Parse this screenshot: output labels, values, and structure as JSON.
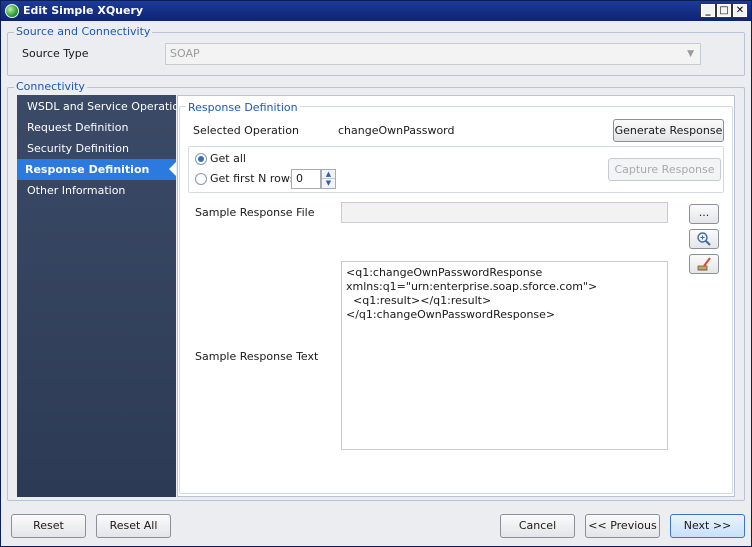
{
  "window": {
    "title": "Edit Simple XQuery"
  },
  "source_group": {
    "legend": "Source and Connectivity",
    "source_type_label": "Source Type",
    "source_type_value": "SOAP"
  },
  "connectivity": {
    "legend": "Connectivity",
    "nav": [
      {
        "label": "WSDL and Service Operation"
      },
      {
        "label": "Request Definition"
      },
      {
        "label": "Security Definition"
      },
      {
        "label": "Response Definition",
        "active": true
      },
      {
        "label": "Other Information"
      }
    ]
  },
  "response": {
    "legend": "Response Definition",
    "selected_operation_label": "Selected Operation",
    "selected_operation_value": "changeOwnPassword",
    "generate_button": "Generate Response",
    "get_all_label": "Get all",
    "get_first_label": "Get first N rows",
    "rows_value": "0",
    "capture_button": "Capture Response",
    "sample_file_label": "Sample Response File",
    "sample_file_value": "",
    "browse_button": "...",
    "sample_text_label": "Sample Response Text",
    "sample_text_value": "<q1:changeOwnPasswordResponse\nxmlns:q1=\"urn:enterprise.soap.sforce.com\">\n  <q1:result></q1:result></q1:changeOwnPasswordResponse>"
  },
  "footer": {
    "reset": "Reset",
    "reset_all": "Reset All",
    "cancel": "Cancel",
    "previous": "<< Previous",
    "next": "Next >>"
  }
}
